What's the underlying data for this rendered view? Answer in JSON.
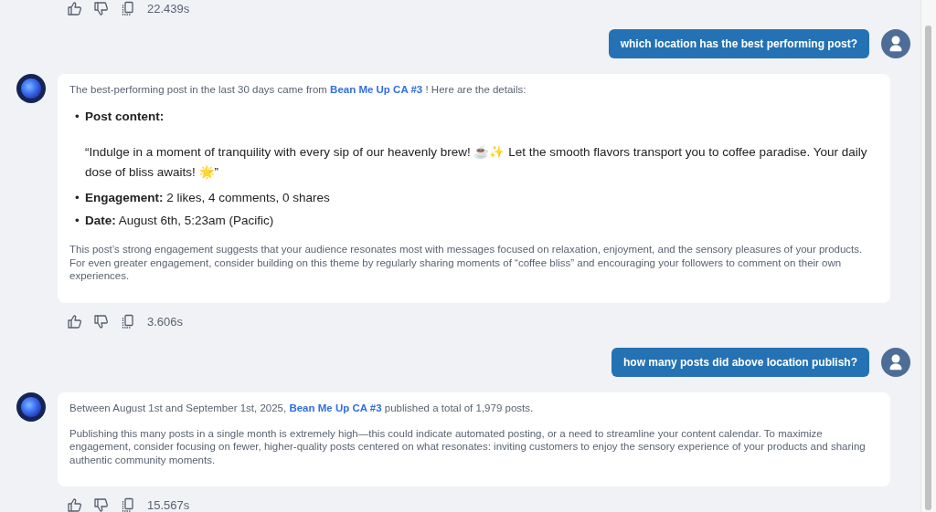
{
  "messages": [
    {
      "kind": "actions",
      "time": "22.439s"
    },
    {
      "kind": "user",
      "text": "which location has the best performing post?"
    },
    {
      "kind": "bot",
      "intro": {
        "before": "The best-performing post in the last 30 days came from",
        "link": "Bean Me Up CA #3",
        "after": "! Here are the details:"
      },
      "bullets": [
        {
          "marker": "•",
          "text": "**Post content:**",
          "quote": "“Indulge in a moment of tranquility with every sip of our heavenly brew! ☕✨ Let the smooth flavors transport you to coffee paradise. Your daily dose of bliss awaits! 🌟”"
        },
        {
          "marker": "•",
          "text": "**Engagement:** 2 likes, 4 comments, 0 shares"
        },
        {
          "marker": "•",
          "text": "**Date:** August 6th, 5:23am (Pacific)"
        }
      ],
      "paragraphs": [
        "This post’s strong engagement suggests that your audience resonates most with messages focused on relaxation, enjoyment, and the sensory pleasures of your products. For even greater engagement, consider building on this theme by regularly sharing moments of “coffee bliss” and encouraging your followers to comment on their own experiences."
      ]
    },
    {
      "kind": "actions",
      "time": "3.606s"
    },
    {
      "kind": "user",
      "text": "how many posts did above location publish?"
    },
    {
      "kind": "bot",
      "intro": {
        "before": "Between August 1st and September 1st, 2025,",
        "link": "Bean Me Up CA #3",
        "after": "published a total of 1,979 posts."
      },
      "paragraphs": [
        "Publishing this many posts in a single month is extremely high—this could indicate automated posting, or a need to streamline your content calendar. To maximize engagement, consider focusing on fewer, higher-quality posts centered on what resonates: inviting customers to enjoy the sensory experience of your products and sharing authentic community moments."
      ]
    },
    {
      "kind": "actions",
      "time": "15.567s"
    }
  ]
}
